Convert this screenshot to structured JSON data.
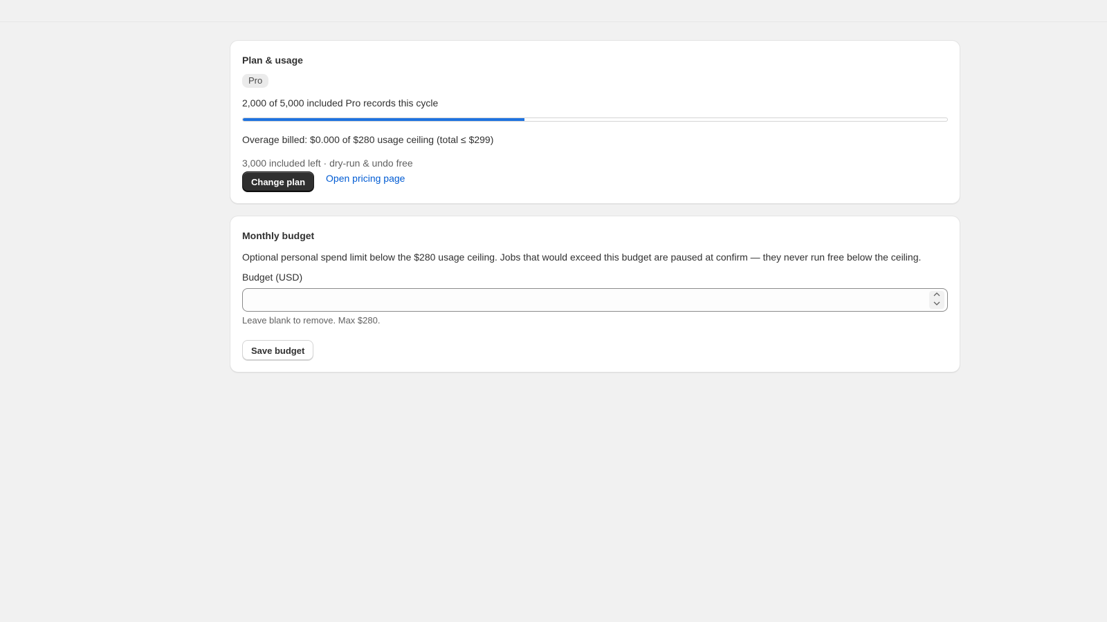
{
  "plan_card": {
    "title": "Plan & usage",
    "plan_badge": "Pro",
    "usage_text": "2,000 of 5,000 included Pro records this cycle",
    "usage_fraction": 0.4,
    "overage_text": "Overage billed: $0.000 of $280 usage ceiling (total ≤ $299)",
    "remaining_text": "3,000 included left · dry-run & undo free",
    "change_plan_label": "Change plan",
    "pricing_link_label": "Open pricing page"
  },
  "budget_card": {
    "title": "Monthly budget",
    "description": "Optional personal spend limit below the $280 usage ceiling. Jobs that would exceed this budget are paused at confirm — they never run free below the ceiling.",
    "field_label": "Budget (USD)",
    "field_value": "",
    "help_text": "Leave blank to remove. Max $280.",
    "save_label": "Save budget"
  },
  "colors": {
    "progress": "#1f73e0",
    "link": "#005bd3",
    "primary_button": "#303030"
  }
}
